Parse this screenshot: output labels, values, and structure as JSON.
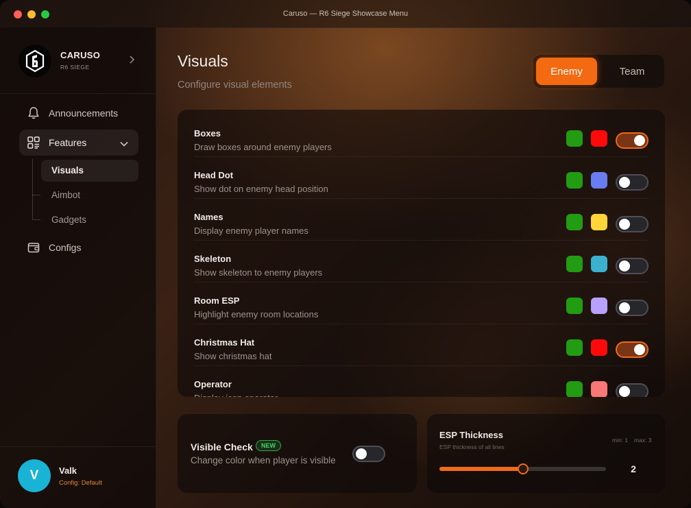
{
  "window": {
    "title": "Caruso — R6 Siege Showcase Menu"
  },
  "sidebar": {
    "brand": {
      "name": "CARUSO",
      "subtitle": "R6 SIEGE"
    },
    "nav": [
      {
        "label": "Announcements",
        "icon": "bell-icon"
      },
      {
        "label": "Features",
        "icon": "grid-icon",
        "expanded": true,
        "children": [
          {
            "label": "Visuals",
            "active": true
          },
          {
            "label": "Aimbot",
            "active": false
          },
          {
            "label": "Gadgets",
            "active": false
          }
        ]
      },
      {
        "label": "Configs",
        "icon": "wallet-icon"
      }
    ],
    "user": {
      "initial": "V",
      "name": "Valk",
      "config": "Config: Default",
      "avatar_color": "#19b3d6"
    }
  },
  "main": {
    "title": "Visuals",
    "subtitle": "Configure visual elements",
    "tabs": [
      {
        "label": "Enemy",
        "selected": true
      },
      {
        "label": "Team",
        "selected": false
      }
    ],
    "features": [
      {
        "name": "Boxes",
        "desc": "Draw boxes around enemy players",
        "color_a": "#229c12",
        "color_b": "#ff0a0a",
        "enabled": true
      },
      {
        "name": "Head Dot",
        "desc": "Show dot on enemy head position",
        "color_a": "#229c12",
        "color_b": "#6a7cf2",
        "enabled": false
      },
      {
        "name": "Names",
        "desc": "Display enemy player names",
        "color_a": "#229c12",
        "color_b": "#ffd43a",
        "enabled": false
      },
      {
        "name": "Skeleton",
        "desc": "Show skeleton to enemy players",
        "color_a": "#229c12",
        "color_b": "#3cb0cf",
        "enabled": false
      },
      {
        "name": "Room ESP",
        "desc": "Highlight enemy room locations",
        "color_a": "#229c12",
        "color_b": "#b9a0ff",
        "enabled": false
      },
      {
        "name": "Christmas Hat",
        "desc": "Show christmas hat",
        "color_a": "#229c12",
        "color_b": "#ff0a0a",
        "enabled": true
      },
      {
        "name": "Operator",
        "desc": "Display icon operator",
        "color_a": "#229c12",
        "color_b": "#f87878",
        "enabled": false
      }
    ],
    "visible_check": {
      "title": "Visible Check",
      "badge": "NEW",
      "desc": "Change color when player is visible",
      "enabled": false
    },
    "esp_thickness": {
      "title": "ESP Thickness",
      "desc": "ESP thickness of all lines",
      "min_label": "min: 1",
      "max_label": "max: 3",
      "min": 1,
      "max": 3,
      "value": 2,
      "value_text": "2"
    }
  },
  "colors": {
    "accent": "#f06a18"
  }
}
